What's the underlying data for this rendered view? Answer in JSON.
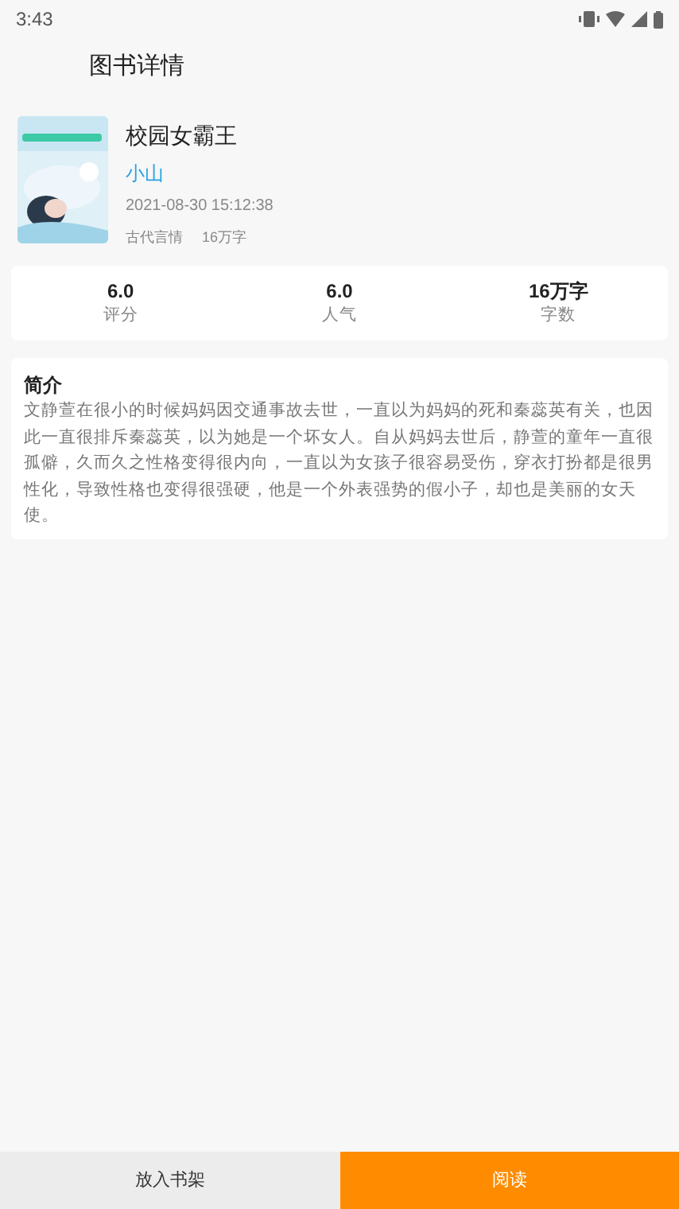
{
  "status_bar": {
    "time": "3:43"
  },
  "header": {
    "title": "图书详情"
  },
  "book": {
    "title": "校园女霸王",
    "author": "小山",
    "updated": "2021-08-30 15:12:38",
    "genre": "古代言情",
    "word_count": "16万字"
  },
  "stats": [
    {
      "value": "6.0",
      "label": "评分"
    },
    {
      "value": "6.0",
      "label": "人气"
    },
    {
      "value": "16万字",
      "label": "字数"
    }
  ],
  "intro": {
    "heading": "简介",
    "text": "文静萱在很小的时候妈妈因交通事故去世，一直以为妈妈的死和秦蕊英有关，也因此一直很排斥秦蕊英，以为她是一个坏女人。自从妈妈去世后，静萱的童年一直很孤僻，久而久之性格变得很内向，一直以为女孩子很容易受伤，穿衣打扮都是很男性化，导致性格也变得很强硬，他是一个外表强势的假小子，却也是美丽的女天使。"
  },
  "actions": [
    {
      "label": "放入书架",
      "kind": "secondary"
    },
    {
      "label": "阅读",
      "kind": "primary"
    }
  ]
}
